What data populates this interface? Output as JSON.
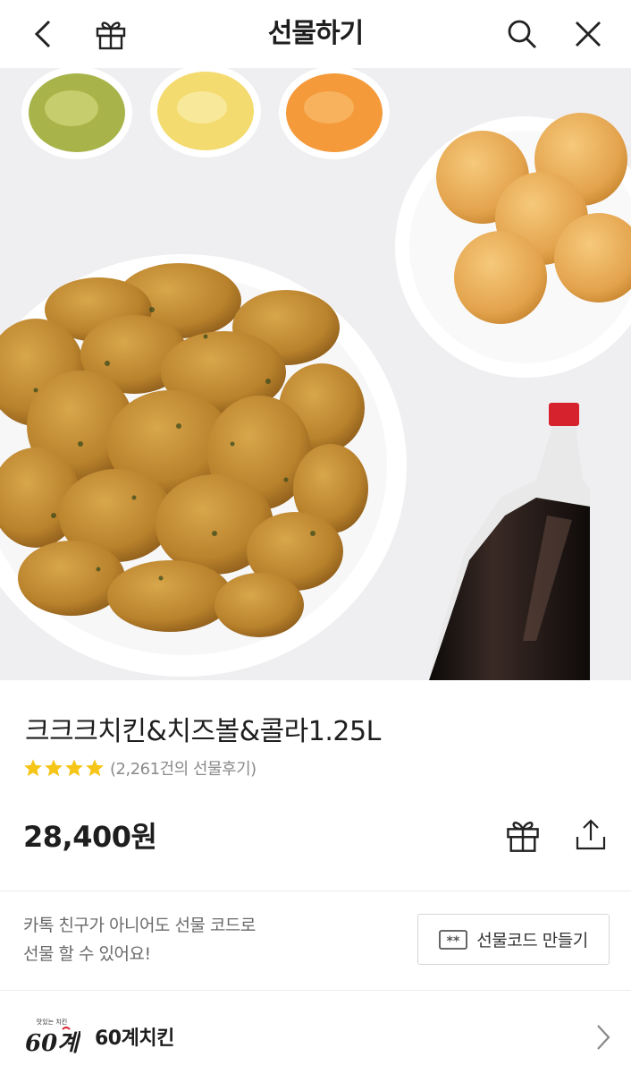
{
  "header": {
    "title": "선물하기",
    "back_icon": "chevron-left-icon",
    "gift_icon": "gift-icon",
    "search_icon": "search-icon",
    "close_icon": "close-icon"
  },
  "product": {
    "name": "크크크치킨&치즈볼&콜라1.25L",
    "rating_stars": 4,
    "review_count": "(2,261건의 선물후기)",
    "price": "28,400원",
    "star_color": "#f5c518"
  },
  "actions": {
    "gift_icon": "gift-icon",
    "share_icon": "share-icon"
  },
  "gift_code": {
    "line1": "카톡 친구가 아니어도 선물 코드로",
    "line2": "선물 할 수 있어요!",
    "button_icon": "code-icon",
    "button_icon_text": "**",
    "button_label": "선물코드 만들기"
  },
  "brand": {
    "logo_text": "60계",
    "logo_tagline": "맛있는 치킨",
    "name": "60계치킨",
    "chevron_icon": "chevron-right-icon"
  }
}
